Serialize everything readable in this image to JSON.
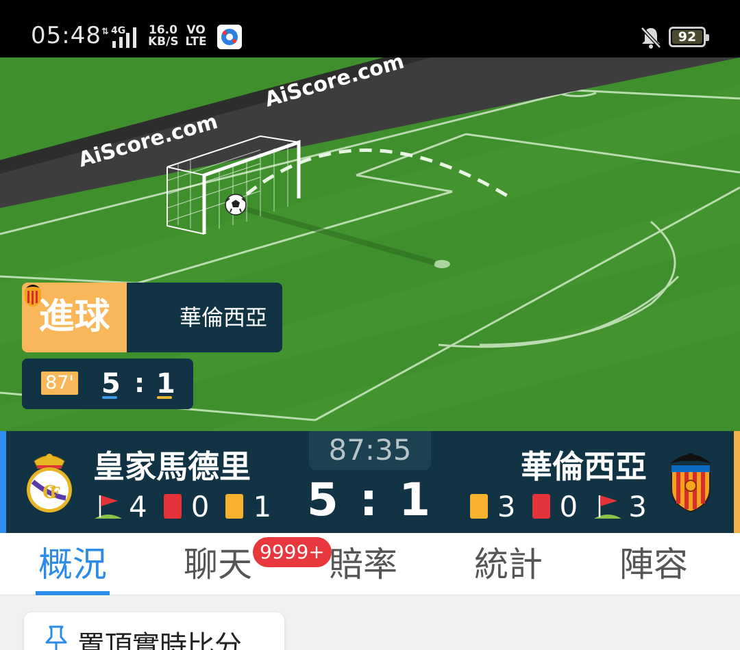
{
  "status_bar": {
    "time": "05:48",
    "network_speed_top": "16.0",
    "network_speed_bottom": "KB/S",
    "volte_top": "VO",
    "volte_bottom": "LTE",
    "signal_label": "4G",
    "battery": "92"
  },
  "pitch": {
    "banner_text_1": "AiScore.com",
    "banner_text_2": "AiScore.com"
  },
  "event": {
    "type": "進球",
    "team": "華倫西亞",
    "minute": "87'",
    "home_score": "5",
    "separator": ":",
    "away_score": "1"
  },
  "match": {
    "home_name": "皇家馬德里",
    "away_name": "華倫西亞",
    "clock": "87:35",
    "score": "5 : 1",
    "home_stats": {
      "corners": "4",
      "red_cards": "0",
      "yellow_cards": "1"
    },
    "away_stats": {
      "yellow_cards": "3",
      "red_cards": "0",
      "corners": "3"
    }
  },
  "tabs": [
    {
      "label": "概況",
      "active": true
    },
    {
      "label": "聊天"
    },
    {
      "label": "賠率"
    },
    {
      "label": "統計"
    },
    {
      "label": "陣容"
    }
  ],
  "chat_badge": "9999+",
  "pin_card": {
    "label": "置頂實時比分"
  },
  "colors": {
    "accent": "#2c8be6",
    "home": "#2f8ef0",
    "away": "#f6b04a",
    "header_bg": "#113344",
    "goal_tag": "#f9b75a"
  }
}
